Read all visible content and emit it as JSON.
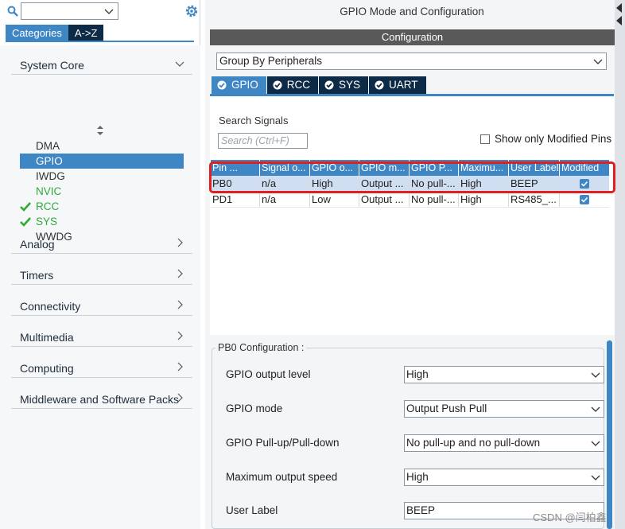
{
  "colors": {
    "accent": "#3f86c5",
    "navy": "#0d2a47",
    "green": "#2eaa3a",
    "highlight": "#e02020",
    "config_bar": "#595959"
  },
  "left": {
    "search": {
      "value": "",
      "icon": "search-icon",
      "dropdown_icon": "chevron-down-icon"
    },
    "settings_icon": "gear-icon",
    "tabs": [
      {
        "label": "Categories",
        "active": true
      },
      {
        "label": "A->Z",
        "active": false
      }
    ],
    "categories": [
      {
        "label": "System Core",
        "expanded": true
      },
      {
        "label": "Analog",
        "expanded": false
      },
      {
        "label": "Timers",
        "expanded": false
      },
      {
        "label": "Connectivity",
        "expanded": false
      },
      {
        "label": "Multimedia",
        "expanded": false
      },
      {
        "label": "Computing",
        "expanded": false
      },
      {
        "label": "Middleware and Software Packs",
        "expanded": false
      }
    ],
    "system_core_items": [
      {
        "label": "DMA",
        "state": "normal"
      },
      {
        "label": "GPIO",
        "state": "selected"
      },
      {
        "label": "IWDG",
        "state": "normal"
      },
      {
        "label": "NVIC",
        "state": "green"
      },
      {
        "label": "RCC",
        "state": "checked"
      },
      {
        "label": "SYS",
        "state": "checked"
      },
      {
        "label": "WWDG",
        "state": "normal"
      }
    ]
  },
  "right": {
    "title": "GPIO Mode and Configuration",
    "config_header": "Configuration",
    "group_by": "Group By Peripherals",
    "peripheral_tabs": [
      {
        "label": "GPIO",
        "active": true
      },
      {
        "label": "RCC",
        "active": false
      },
      {
        "label": "SYS",
        "active": false
      },
      {
        "label": "UART",
        "active": false
      }
    ],
    "search_signals_label": "Search Signals",
    "search_placeholder": "Search (Ctrl+F)",
    "show_modified_label": "Show only Modified Pins",
    "show_modified_checked": false,
    "table": {
      "headers": [
        "Pin ...",
        "Signal o...",
        "GPIO o...",
        "GPIO m...",
        "GPIO P...",
        "Maximu...",
        "User Label",
        "Modified"
      ],
      "rows": [
        {
          "cells": [
            "PB0",
            "n/a",
            "High",
            "Output ...",
            "No pull-...",
            "High",
            "BEEP"
          ],
          "modified": true,
          "selected": true
        },
        {
          "cells": [
            "PD1",
            "n/a",
            "Low",
            "Output ...",
            "No pull-...",
            "High",
            "RS485_..."
          ],
          "modified": true,
          "selected": false
        }
      ]
    },
    "pb0_config": {
      "title": "PB0 Configuration :",
      "fields": [
        {
          "label": "GPIO output level",
          "value": "High",
          "kind": "select"
        },
        {
          "label": "GPIO mode",
          "value": "Output Push Pull",
          "kind": "select"
        },
        {
          "label": "GPIO Pull-up/Pull-down",
          "value": "No pull-up and no pull-down",
          "kind": "select"
        },
        {
          "label": "Maximum output speed",
          "value": "High",
          "kind": "select"
        },
        {
          "label": "User Label",
          "value": "BEEP",
          "kind": "input"
        }
      ]
    }
  },
  "watermark": "CSDN @闫柏鑫"
}
